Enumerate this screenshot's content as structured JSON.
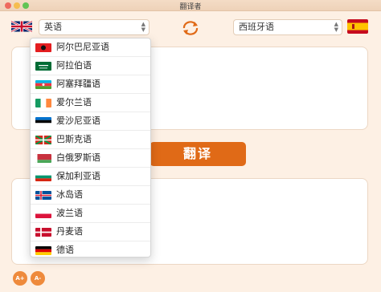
{
  "window": {
    "title": "翻译者"
  },
  "source_language": {
    "selected": "英语",
    "flag_icon": "uk-flag-icon"
  },
  "target_language": {
    "selected": "西班牙语",
    "flag_icon": "spain-flag-icon"
  },
  "translate_button": {
    "label": "翻译"
  },
  "font_controls": {
    "increase_label": "A+",
    "decrease_label": "A-"
  },
  "dropdown": {
    "items": [
      {
        "label": "阿尔巴尼亚语",
        "flag": "albania-flag-icon"
      },
      {
        "label": "阿拉伯语",
        "flag": "saudi-flag-icon"
      },
      {
        "label": "阿塞拜疆语",
        "flag": "azerbaijan-flag-icon"
      },
      {
        "label": "爱尔兰语",
        "flag": "ireland-flag-icon"
      },
      {
        "label": "爱沙尼亚语",
        "flag": "estonia-flag-icon"
      },
      {
        "label": "巴斯克语",
        "flag": "basque-flag-icon"
      },
      {
        "label": "白俄罗斯语",
        "flag": "belarus-flag-icon"
      },
      {
        "label": "保加利亚语",
        "flag": "bulgaria-flag-icon"
      },
      {
        "label": "冰岛语",
        "flag": "iceland-flag-icon"
      },
      {
        "label": "波兰语",
        "flag": "poland-flag-icon"
      },
      {
        "label": "丹麦语",
        "flag": "denmark-flag-icon"
      },
      {
        "label": "德语",
        "flag": "germany-flag-icon"
      }
    ]
  },
  "colors": {
    "accent": "#e06a17",
    "background": "#fdf0e4"
  }
}
